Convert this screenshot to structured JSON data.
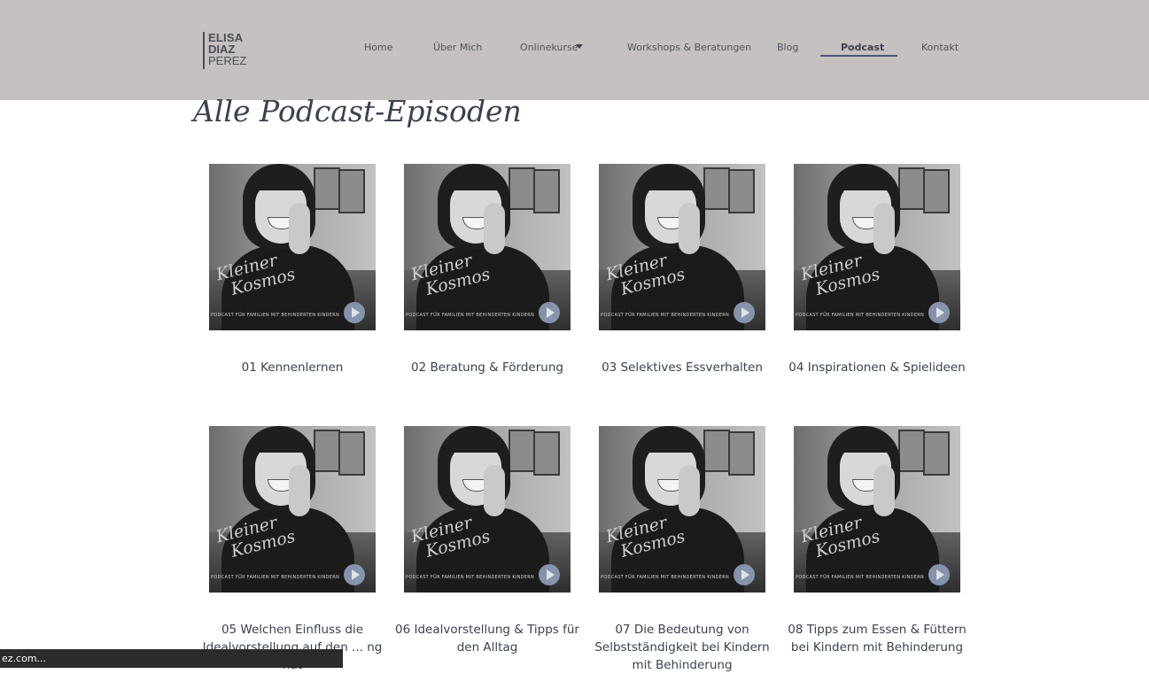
{
  "brand": {
    "line1": "ELISA",
    "line2": "DIAZ",
    "line3": "PEREZ"
  },
  "nav": {
    "items": [
      {
        "label": "Home"
      },
      {
        "label": "Über Mich"
      },
      {
        "label": "Onlinekurse"
      },
      {
        "label": "Workshops & Beratungen"
      },
      {
        "label": "Blog"
      },
      {
        "label": "Podcast"
      },
      {
        "label": "Kontakt"
      }
    ],
    "active": "Podcast"
  },
  "page": {
    "title": "Alle Podcast-Episoden"
  },
  "thumbnail": {
    "script_line1": "Kleiner",
    "script_line2": "Kosmos",
    "tagline": "PODCAST FÜR FAMILIEN MIT BEHINDERTEN KINDERN"
  },
  "episodes": [
    {
      "title": "01 Kennenlernen"
    },
    {
      "title": "02 Beratung & Förderung"
    },
    {
      "title": "03 Selektives Essverhalten"
    },
    {
      "title": "04 Inspirationen & Spielideen"
    },
    {
      "title": "05 Welchen Einfluss die Idealvorstellung auf den ... ng hat"
    },
    {
      "title": "06 Idealvorstellung & Tipps für den Alltag"
    },
    {
      "title": "07 Die Bedeutung von Selbstständigkeit bei Kindern mit Behinderung"
    },
    {
      "title": "08 Tipps zum Essen & Füttern bei Kindern mit Behinderung"
    }
  ],
  "status_bar": {
    "text": "ez.com..."
  },
  "colors": {
    "header_bg": "#c5c1c0",
    "text": "#3b4150",
    "accent": "#4a5778",
    "play_button": "#8a9ab3"
  }
}
